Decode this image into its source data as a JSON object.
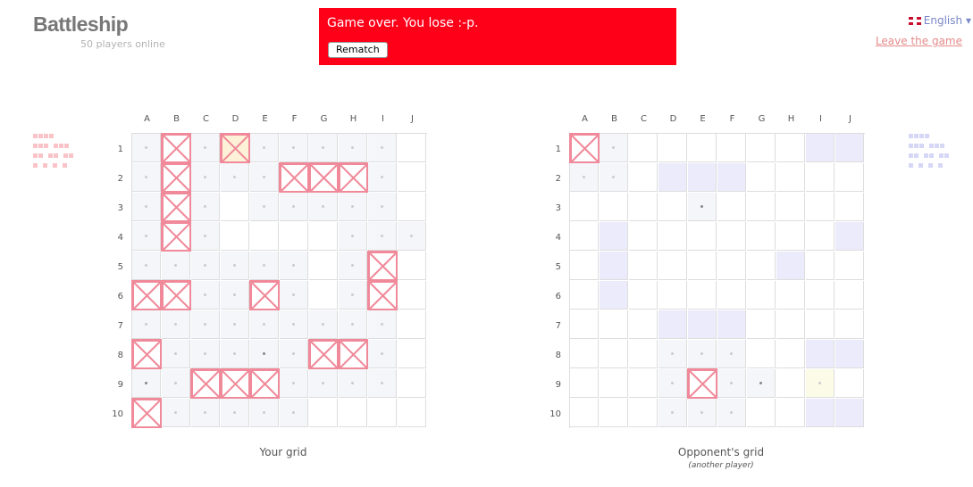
{
  "header": {
    "title": "Battleship",
    "online": "50 players online",
    "language": "English",
    "leave": "Leave the game"
  },
  "banner": {
    "message": "Game over. You lose :-p.",
    "button": "Rematch"
  },
  "grid": {
    "columns": [
      "A",
      "B",
      "C",
      "D",
      "E",
      "F",
      "G",
      "H",
      "I",
      "J"
    ],
    "rows": [
      "1",
      "2",
      "3",
      "4",
      "5",
      "6",
      "7",
      "8",
      "9",
      "10"
    ]
  },
  "captions": {
    "mine": "Your grid",
    "opponent": "Opponent's grid",
    "opponent_sub": "(another player)"
  },
  "colors": {
    "banner": "#ff0019",
    "hit": "#f08a9a",
    "miss_bg": "#f5f6fa",
    "opponent_ship": "#ebebfb"
  }
}
